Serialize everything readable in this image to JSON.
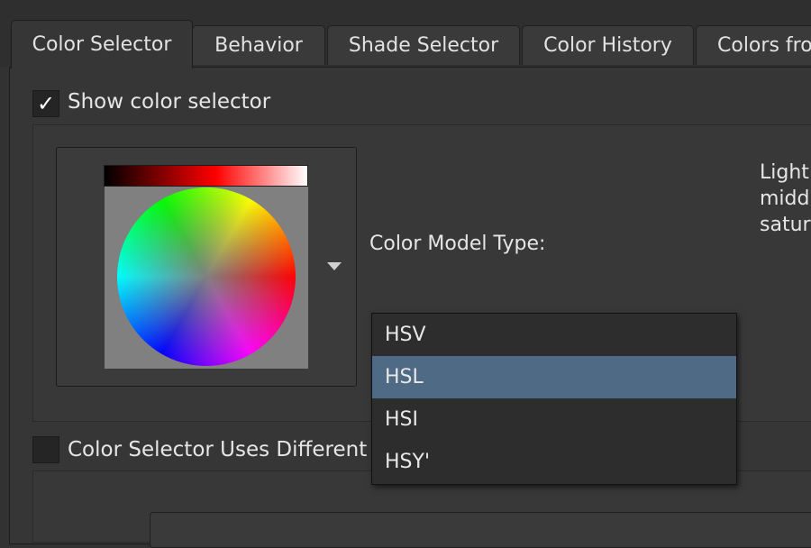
{
  "tabs": [
    {
      "label": "Color Selector",
      "active": true
    },
    {
      "label": "Behavior",
      "active": false
    },
    {
      "label": "Shade Selector",
      "active": false
    },
    {
      "label": "Color History",
      "active": false
    },
    {
      "label": "Colors fro",
      "active": false
    }
  ],
  "show_color_selector": {
    "label": "Show color selector",
    "checked": true,
    "check_glyph": "✓"
  },
  "color_model": {
    "label": "Color Model Type:",
    "options": [
      "HSV",
      "HSL",
      "HSI",
      "HSY'"
    ],
    "selected": "HSL"
  },
  "description_lines": [
    "Light",
    "middl",
    "satur"
  ],
  "uses_different": {
    "label": "Color Selector Uses Different",
    "checked": false
  },
  "icons": {
    "dropdown": "triangle-down-icon",
    "check": "checkmark-icon"
  }
}
